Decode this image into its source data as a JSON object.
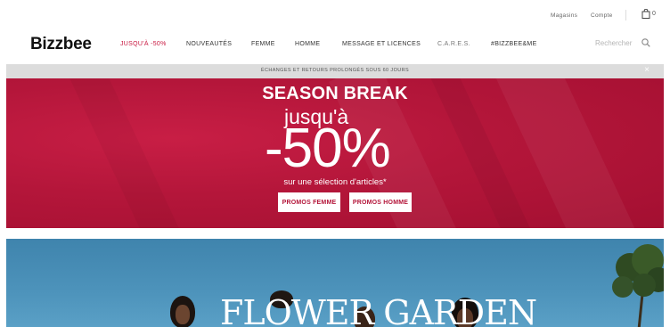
{
  "utility": {
    "stores_label": "Magasins",
    "account_label": "Compte",
    "cart_count": "0"
  },
  "brand": {
    "logo_text": "Bizzbee",
    "accent_color": "#c8173f"
  },
  "nav": {
    "items": [
      {
        "label": "JUSQU'À -50%"
      },
      {
        "label": "NOUVEAUTÉS"
      },
      {
        "label": "FEMME"
      },
      {
        "label": "HOMME"
      },
      {
        "label": "MESSAGE ET LICENCES"
      },
      {
        "label": "C.A.R.E.S."
      },
      {
        "label": "#BIZZBEE&ME"
      }
    ]
  },
  "search": {
    "placeholder": "Rechercher",
    "icon": "search-icon"
  },
  "announcement": {
    "text": "ÉCHANGES ET RETOURS PROLONGÉS SOUS 60 JOURS",
    "close": "×"
  },
  "hero": {
    "title": "SEASON BREAK",
    "line1": "jusqu'à",
    "discount": "-50%",
    "subtitle": "sur une sélection d'articles*",
    "btn_women": "PROMOS FEMME",
    "btn_men": "PROMOS HOMME",
    "background_color": "#b4163a"
  },
  "banner2": {
    "title": "FLOWER GARDEN"
  }
}
